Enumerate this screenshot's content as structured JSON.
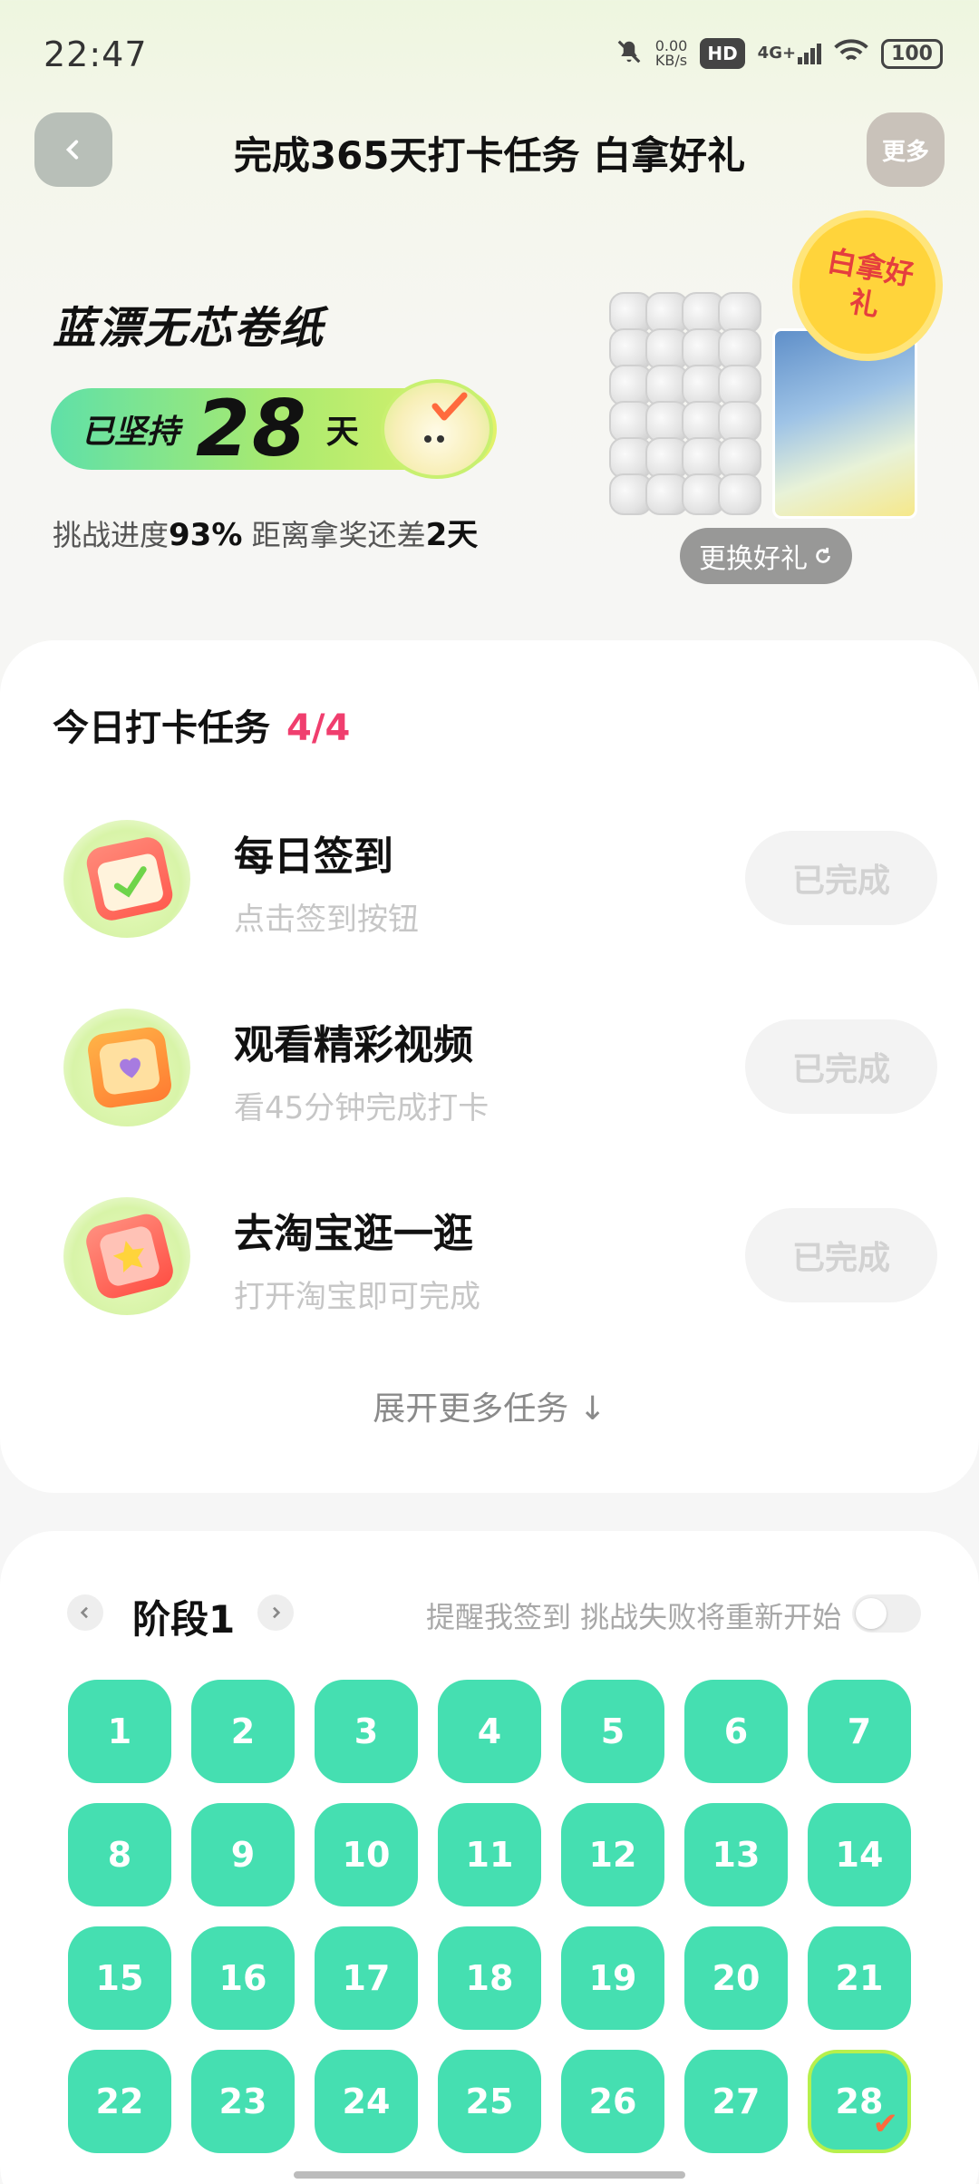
{
  "status_bar": {
    "time": "22:47",
    "net_speed_value": "0.00",
    "net_speed_unit": "KB/s",
    "hd": "HD",
    "signal": "4G+",
    "battery": "100"
  },
  "header": {
    "title": "完成365天打卡任务 白拿好礼",
    "more_label": "更多"
  },
  "hero": {
    "product_name": "蓝漂无芯卷纸",
    "streak_prefix": "已坚持",
    "streak_days": "28",
    "streak_suffix": "天",
    "progress_prefix": "挑战进度",
    "progress_value": "93%",
    "progress_middle": " 距离拿奖还差",
    "days_left": "2天",
    "gift_badge": "白拿好礼",
    "change_gift_label": "更换好礼"
  },
  "tasks": {
    "title": "今日打卡任务",
    "count": "4/4",
    "items": [
      {
        "name": "每日签到",
        "desc": "点击签到按钮",
        "button": "已完成",
        "icon": "calendar-check-icon"
      },
      {
        "name": "观看精彩视频",
        "desc": "看45分钟完成打卡",
        "button": "已完成",
        "icon": "video-heart-icon"
      },
      {
        "name": "去淘宝逛一逛",
        "desc": "打开淘宝即可完成",
        "button": "已完成",
        "icon": "taobao-star-icon"
      }
    ],
    "expand_label": "展开更多任务 ↓"
  },
  "calendar": {
    "stage_label": "阶段1",
    "remind_label": "提醒我签到 挑战失败将重新开始",
    "remind_toggle": "off",
    "days": [
      "1",
      "2",
      "3",
      "4",
      "5",
      "6",
      "7",
      "8",
      "9",
      "10",
      "11",
      "12",
      "13",
      "14",
      "15",
      "16",
      "17",
      "18",
      "19",
      "20",
      "21",
      "22",
      "23",
      "24",
      "25",
      "26",
      "27",
      "28"
    ],
    "completed_color": "#45dfb1"
  }
}
